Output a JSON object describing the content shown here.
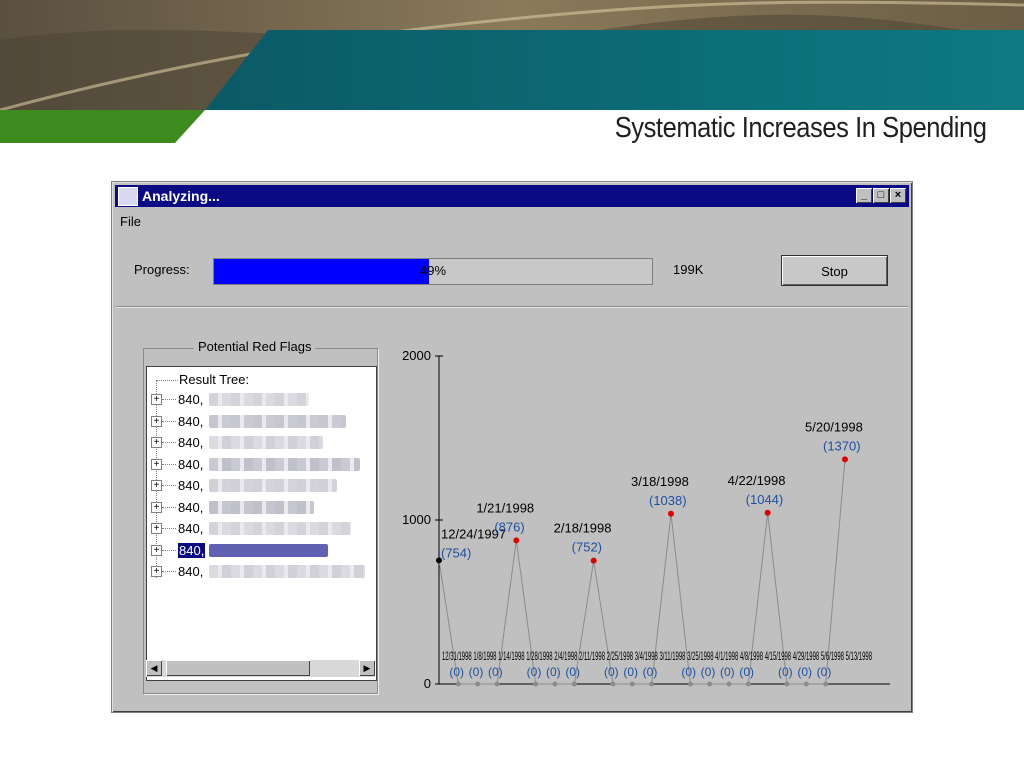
{
  "slide": {
    "title": "Systematic Increases In Spending"
  },
  "window": {
    "title": "Analyzing...",
    "menu": [
      "File"
    ],
    "progress_label": "Progress:",
    "progress_value": 0.49,
    "progress_text": "49%",
    "size_text": "199K",
    "stop_label": "Stop"
  },
  "tree": {
    "group_title": "Potential Red Flags",
    "root_label": "Result Tree:",
    "items": [
      {
        "label": "840,",
        "selected": false
      },
      {
        "label": "840,",
        "selected": false
      },
      {
        "label": "840,",
        "selected": false
      },
      {
        "label": "840,",
        "selected": false
      },
      {
        "label": "840,",
        "selected": false
      },
      {
        "label": "840,",
        "selected": false
      },
      {
        "label": "840,",
        "selected": false
      },
      {
        "label": "840,",
        "selected": true
      },
      {
        "label": "840,",
        "selected": false
      }
    ]
  },
  "chart_data": {
    "type": "line",
    "ylim": [
      0,
      2000
    ],
    "yticks": [
      0,
      1000,
      2000
    ],
    "highlight_color": "#e00000",
    "label_color": "#1f4fa0",
    "line_color": "#8c8c8c",
    "points": [
      {
        "date": "12/24/1997",
        "value": 754
      },
      {
        "date": "",
        "value": 0
      },
      {
        "date": "",
        "value": 0
      },
      {
        "date": "",
        "value": 0
      },
      {
        "date": "1/21/1998",
        "value": 876
      },
      {
        "date": "",
        "value": 0
      },
      {
        "date": "",
        "value": 0
      },
      {
        "date": "",
        "value": 0
      },
      {
        "date": "2/18/1998",
        "value": 752
      },
      {
        "date": "",
        "value": 0
      },
      {
        "date": "",
        "value": 0
      },
      {
        "date": "",
        "value": 0
      },
      {
        "date": "3/18/1998",
        "value": 1038
      },
      {
        "date": "",
        "value": 0
      },
      {
        "date": "",
        "value": 0
      },
      {
        "date": "",
        "value": 0
      },
      {
        "date": "",
        "value": 0
      },
      {
        "date": "4/22/1998",
        "value": 1044
      },
      {
        "date": "",
        "value": 0
      },
      {
        "date": "",
        "value": 0
      },
      {
        "date": "",
        "value": 0
      },
      {
        "date": "5/20/1998",
        "value": 1370
      }
    ],
    "zero_label_text": "(0)",
    "overlap_text": "12/31/1998 1/8/1998 1/14/1998 1/28/1998 2/4/1998 2/11/1998 2/25/1998 3/4/1998 3/11/1998 3/25/1998 4/1/1998 4/8/1998 4/15/1998 4/29/1998 5/6/1998 5/13/1998"
  }
}
